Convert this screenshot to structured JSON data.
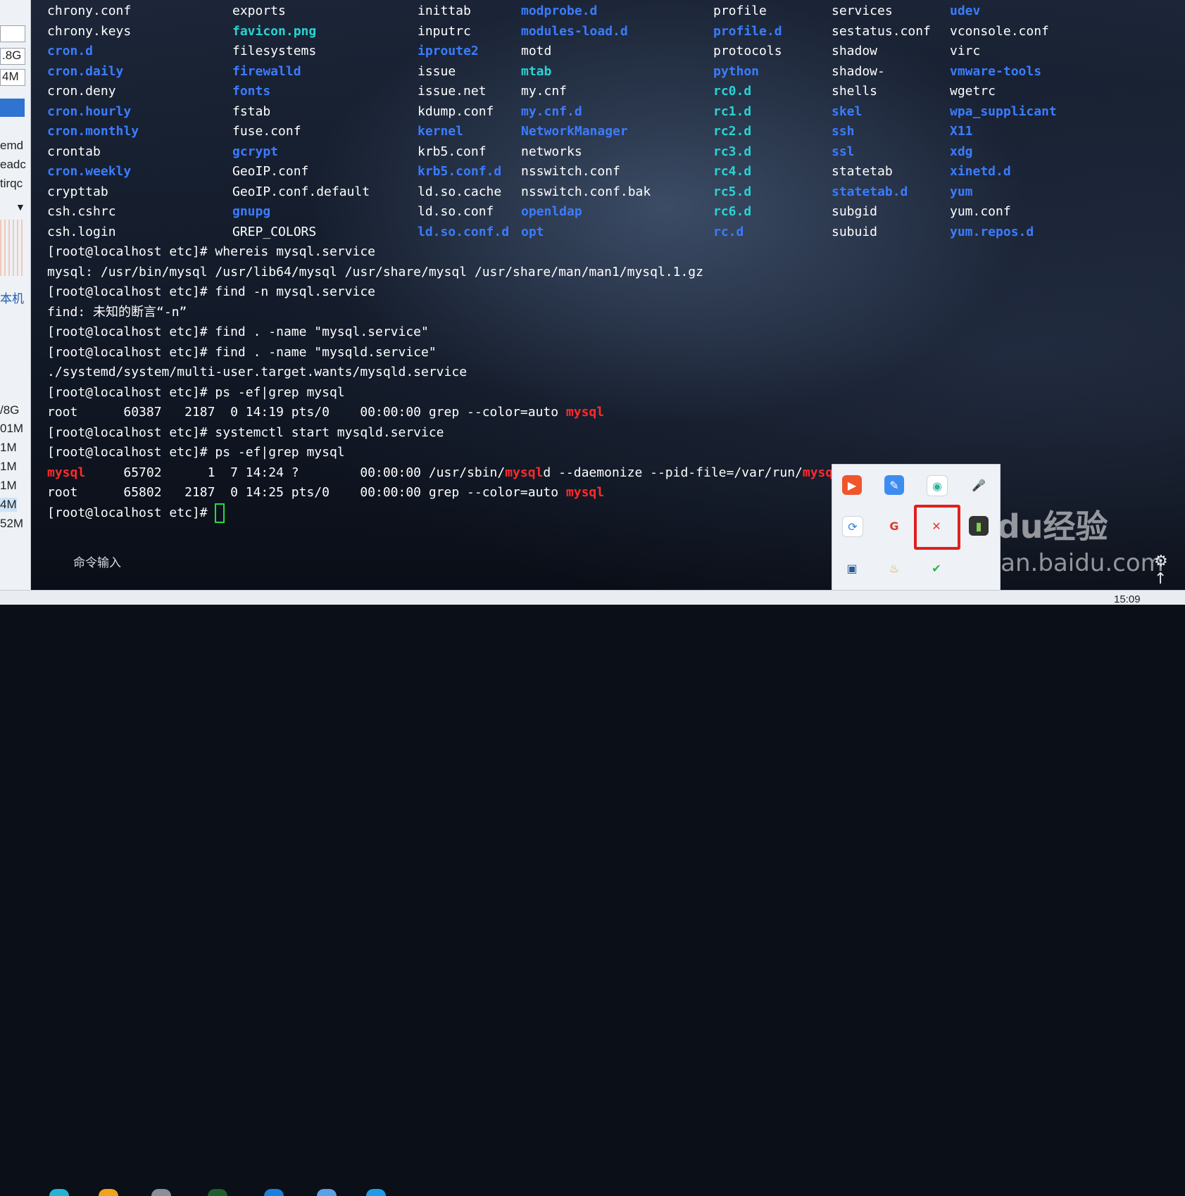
{
  "left_panel": {
    "items": [
      ".8G",
      "4M",
      "emd",
      "eadc",
      "tirqc",
      "本机",
      "/8G",
      "01M",
      "1M",
      "1M",
      "1M",
      "4M",
      "52M"
    ]
  },
  "terminal": {
    "ls_rows": [
      [
        [
          "f",
          "chrony.conf"
        ],
        [
          "f",
          "exports"
        ],
        [
          "f",
          "inittab"
        ],
        [
          "d",
          "modprobe.d"
        ],
        [
          "f",
          "profile"
        ],
        [
          "f",
          "services"
        ],
        [
          "d",
          "udev"
        ]
      ],
      [
        [
          "f",
          "chrony.keys"
        ],
        [
          "c",
          "favicon.png"
        ],
        [
          "f",
          "inputrc"
        ],
        [
          "d",
          "modules-load.d"
        ],
        [
          "d",
          "profile.d"
        ],
        [
          "f",
          "sestatus.conf"
        ],
        [
          "f",
          "vconsole.conf"
        ]
      ],
      [
        [
          "d",
          "cron.d"
        ],
        [
          "f",
          "filesystems"
        ],
        [
          "d",
          "iproute2"
        ],
        [
          "f",
          "motd"
        ],
        [
          "f",
          "protocols"
        ],
        [
          "f",
          "shadow"
        ],
        [
          "f",
          "virc"
        ]
      ],
      [
        [
          "d",
          "cron.daily"
        ],
        [
          "d",
          "firewalld"
        ],
        [
          "f",
          "issue"
        ],
        [
          "c",
          "mtab"
        ],
        [
          "d",
          "python"
        ],
        [
          "f",
          "shadow-"
        ],
        [
          "d",
          "vmware-tools"
        ]
      ],
      [
        [
          "f",
          "cron.deny"
        ],
        [
          "d",
          "fonts"
        ],
        [
          "f",
          "issue.net"
        ],
        [
          "f",
          "my.cnf"
        ],
        [
          "c",
          "rc0.d"
        ],
        [
          "f",
          "shells"
        ],
        [
          "f",
          "wgetrc"
        ]
      ],
      [
        [
          "d",
          "cron.hourly"
        ],
        [
          "f",
          "fstab"
        ],
        [
          "f",
          "kdump.conf"
        ],
        [
          "d",
          "my.cnf.d"
        ],
        [
          "c",
          "rc1.d"
        ],
        [
          "d",
          "skel"
        ],
        [
          "d",
          "wpa_supplicant"
        ]
      ],
      [
        [
          "d",
          "cron.monthly"
        ],
        [
          "f",
          "fuse.conf"
        ],
        [
          "d",
          "kernel"
        ],
        [
          "d",
          "NetworkManager"
        ],
        [
          "c",
          "rc2.d"
        ],
        [
          "d",
          "ssh"
        ],
        [
          "d",
          "X11"
        ]
      ],
      [
        [
          "f",
          "crontab"
        ],
        [
          "d",
          "gcrypt"
        ],
        [
          "f",
          "krb5.conf"
        ],
        [
          "f",
          "networks"
        ],
        [
          "c",
          "rc3.d"
        ],
        [
          "d",
          "ssl"
        ],
        [
          "d",
          "xdg"
        ]
      ],
      [
        [
          "d",
          "cron.weekly"
        ],
        [
          "f",
          "GeoIP.conf"
        ],
        [
          "d",
          "krb5.conf.d"
        ],
        [
          "f",
          "nsswitch.conf"
        ],
        [
          "c",
          "rc4.d"
        ],
        [
          "f",
          "statetab"
        ],
        [
          "d",
          "xinetd.d"
        ]
      ],
      [
        [
          "f",
          "crypttab"
        ],
        [
          "f",
          "GeoIP.conf.default"
        ],
        [
          "f",
          "ld.so.cache"
        ],
        [
          "f",
          "nsswitch.conf.bak"
        ],
        [
          "c",
          "rc5.d"
        ],
        [
          "d",
          "statetab.d"
        ],
        [
          "d",
          "yum"
        ]
      ],
      [
        [
          "f",
          "csh.cshrc"
        ],
        [
          "d",
          "gnupg"
        ],
        [
          "f",
          "ld.so.conf"
        ],
        [
          "d",
          "openldap"
        ],
        [
          "c",
          "rc6.d"
        ],
        [
          "f",
          "subgid"
        ],
        [
          "f",
          "yum.conf"
        ]
      ],
      [
        [
          "f",
          "csh.login"
        ],
        [
          "f",
          "GREP_COLORS"
        ],
        [
          "d",
          "ld.so.conf.d"
        ],
        [
          "d",
          "opt"
        ],
        [
          "d",
          "rc.d"
        ],
        [
          "f",
          "subuid"
        ],
        [
          "d",
          "yum.repos.d"
        ]
      ]
    ],
    "lines": {
      "l1": "[root@localhost etc]# whereis mysql.service",
      "l2": "mysql: /usr/bin/mysql /usr/lib64/mysql /usr/share/mysql /usr/share/man/man1/mysql.1.gz",
      "l3": "[root@localhost etc]# find -n mysql.service",
      "l4": "find: 未知的断言“-n”",
      "l5": "[root@localhost etc]# find . -name \"mysql.service\"",
      "l6": "[root@localhost etc]# find . -name \"mysqld.service\"",
      "l7": "./systemd/system/multi-user.target.wants/mysqld.service",
      "l8": "[root@localhost etc]# ps -ef|grep mysql",
      "l9a": "root      60387   2187  0 14:19 pts/0    00:00:00 grep --color=auto ",
      "l9b": "mysql",
      "l10": "[root@localhost etc]# systemctl start mysqld.service",
      "l11": "[root@localhost etc]# ps -ef|grep mysql",
      "l12a": "mysql",
      "l12b": "     65702      1  7 14:24 ?        00:00:00 /usr/sbin/",
      "l12c": "mysql",
      "l12d": "d --daemonize --pid-file=/var/run/",
      "l12e": "mysql",
      "l12f": "d/",
      "l13a": "root      65802   2187  0 14:25 pts/0    00:00:00 grep --color=auto ",
      "l13b": "mysql",
      "l14": "[root@localhost etc]# "
    },
    "command_input_label": "命令输入"
  },
  "tray": {
    "icons": [
      "video-player-icon",
      "notes-icon",
      "eye-protect-icon",
      "microphone-icon",
      "search-sync-icon",
      "red-app-icon",
      "highlighted-app-icon",
      "battery-icon",
      "network-icon",
      "flame-icon",
      "green-app-icon"
    ]
  },
  "watermark": {
    "line1": "Baidu经验",
    "line2": "jingyan.baidu.com"
  },
  "taskbar": {
    "clock": "15:09"
  },
  "colors": {
    "dir": "#3b7cff",
    "link": "#2bd3d3",
    "match": "#ff2b2b",
    "cursor": "#22dd44",
    "highlight": "#e0201c"
  }
}
